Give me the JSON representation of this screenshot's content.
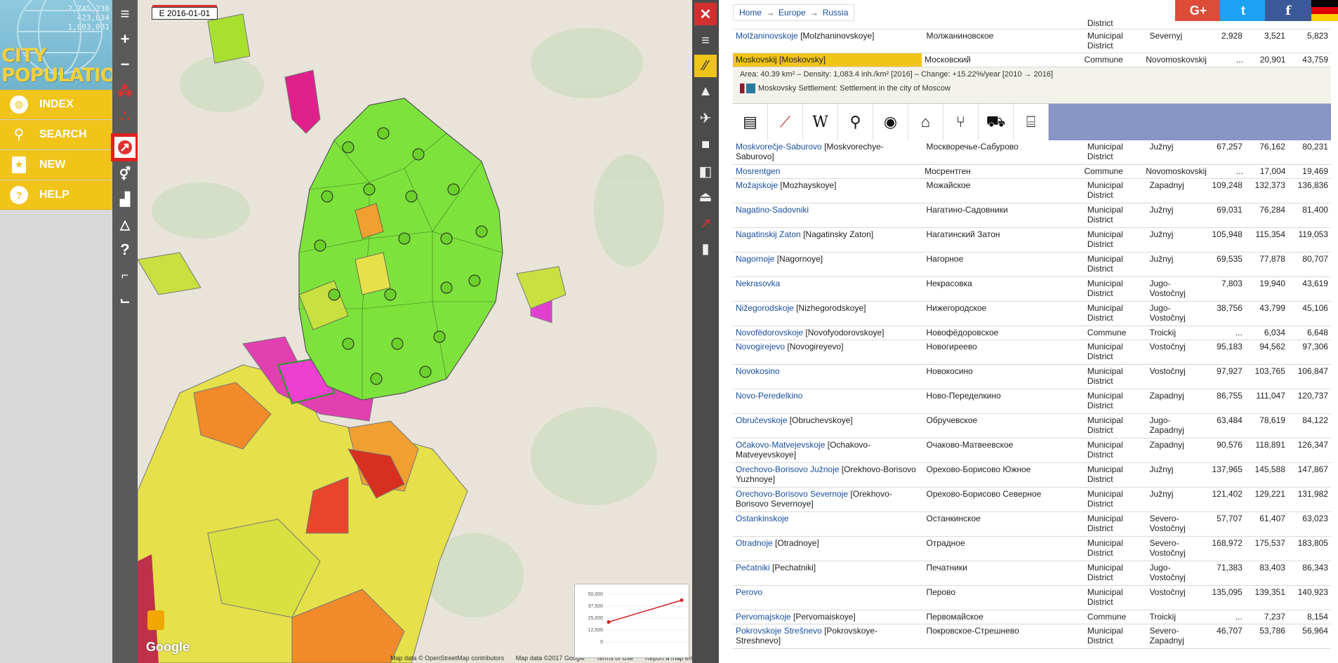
{
  "logo": {
    "counts": [
      "2,745,238",
      "423,034",
      "1,003,081"
    ],
    "line1": "CITY",
    "line2": "POPULATION"
  },
  "menu": [
    {
      "label": "INDEX",
      "icon": "globe-icon"
    },
    {
      "label": "SEARCH",
      "icon": "search-icon"
    },
    {
      "label": "NEW",
      "icon": "star-icon"
    },
    {
      "label": "HELP",
      "icon": "question-icon"
    }
  ],
  "map": {
    "date": "E 2016-01-01",
    "footer": [
      "Map data © OpenStreetMap contributors",
      "Map data ©2017 Google",
      "Terms of Use",
      "Report a map error"
    ],
    "google": "Google",
    "minichart": {
      "ylabels": [
        "50,000",
        "37,500",
        "25,000",
        "12,500",
        "0"
      ],
      "values": [
        20901,
        43759
      ]
    }
  },
  "breadcrumb": [
    "Home",
    "Europe",
    "Russia"
  ],
  "social": {
    "google": "G+",
    "twitter": "t",
    "facebook": "f"
  },
  "selected_detail": {
    "line1": "Area: 40.39 km² – Density: 1,083.4 inh./km² [2016] – Change: +15.22%/year [2010 → 2016]",
    "line2": "Moskovsky Settlement: Settlement in the city of Moscow"
  },
  "rows_top": [
    {
      "name": "",
      "alt": "",
      "cyr": "",
      "status": "District",
      "region": "",
      "p1": "",
      "p2": "",
      "p3": ""
    },
    {
      "name": "Molžaninovskoje",
      "alt": "[Molzhaninovskoye]",
      "cyr": "Молжаниновское",
      "status": "Municipal District",
      "region": "Severnyj",
      "p1": "2,928",
      "p2": "3,521",
      "p3": "5,823"
    },
    {
      "name": "Moskovskij",
      "alt": "[Moskovsky]",
      "cyr": "Московский",
      "status": "Commune",
      "region": "Novomoskovskij",
      "p1": "...",
      "p2": "20,901",
      "p3": "43,759"
    }
  ],
  "rows": [
    {
      "name": "Moskvorečje-Saburovo",
      "alt": "[Moskvorechye-Saburovo]",
      "cyr": "Москворечье-Сабурово",
      "status": "Municipal District",
      "region": "Južnyj",
      "p1": "67,257",
      "p2": "76,162",
      "p3": "80,231"
    },
    {
      "name": "Mosrentgen",
      "alt": "",
      "cyr": "Мосрентген",
      "status": "Commune",
      "region": "Novomoskovskij",
      "p1": "...",
      "p2": "17,004",
      "p3": "19,469"
    },
    {
      "name": "Možajskoje",
      "alt": "[Mozhayskoye]",
      "cyr": "Можайское",
      "status": "Municipal District",
      "region": "Zapadnyj",
      "p1": "109,248",
      "p2": "132,373",
      "p3": "136,836"
    },
    {
      "name": "Nagatino-Sadovniki",
      "alt": "",
      "cyr": "Нагатино-Садовники",
      "status": "Municipal District",
      "region": "Južnyj",
      "p1": "69,031",
      "p2": "76,284",
      "p3": "81,400"
    },
    {
      "name": "Nagatinskij Zaton",
      "alt": "[Nagatinsky Zaton]",
      "cyr": "Нагатинский Затон",
      "status": "Municipal District",
      "region": "Južnyj",
      "p1": "105,948",
      "p2": "115,354",
      "p3": "119,053"
    },
    {
      "name": "Nagornoje",
      "alt": "[Nagornoye]",
      "cyr": "Нагорное",
      "status": "Municipal District",
      "region": "Južnyj",
      "p1": "69,535",
      "p2": "77,878",
      "p3": "80,707"
    },
    {
      "name": "Nekrasovka",
      "alt": "",
      "cyr": "Некрасовка",
      "status": "Municipal District",
      "region": "Jugo-Vostočnyj",
      "p1": "7,803",
      "p2": "19,940",
      "p3": "43,619"
    },
    {
      "name": "Nižegorodskoje",
      "alt": "[Nizhegorodskoye]",
      "cyr": "Нижегородское",
      "status": "Municipal District",
      "region": "Jugo-Vostočnyj",
      "p1": "38,756",
      "p2": "43,799",
      "p3": "45,106"
    },
    {
      "name": "Novofëdorovskoje",
      "alt": "[Novofyodorovskoye]",
      "cyr": "Новофёдоровское",
      "status": "Commune",
      "region": "Troickij",
      "p1": "...",
      "p2": "6,034",
      "p3": "6,648"
    },
    {
      "name": "Novogirejevo",
      "alt": "[Novogireyevo]",
      "cyr": "Новогиреево",
      "status": "Municipal District",
      "region": "Vostočnyj",
      "p1": "95,183",
      "p2": "94,562",
      "p3": "97,306"
    },
    {
      "name": "Novokosino",
      "alt": "",
      "cyr": "Новокосино",
      "status": "Municipal District",
      "region": "Vostočnyj",
      "p1": "97,927",
      "p2": "103,765",
      "p3": "106,847"
    },
    {
      "name": "Novo-Peredelkino",
      "alt": "",
      "cyr": "Ново-Переделкино",
      "status": "Municipal District",
      "region": "Zapadnyj",
      "p1": "86,755",
      "p2": "111,047",
      "p3": "120,737"
    },
    {
      "name": "Obručevskoje",
      "alt": "[Obruchevskoye]",
      "cyr": "Обручевское",
      "status": "Municipal District",
      "region": "Jugo-Zapadnyj",
      "p1": "63,484",
      "p2": "78,619",
      "p3": "84,122"
    },
    {
      "name": "Očakovo-Matvejevskoje",
      "alt": "[Ochakovo-Matveyevskoye]",
      "cyr": "Очаково-Матвеевское",
      "status": "Municipal District",
      "region": "Zapadnyj",
      "p1": "90,576",
      "p2": "118,891",
      "p3": "126,347"
    },
    {
      "name": "Orechovo-Borisovo Južnoje",
      "alt": "[Orekhovo-Borisovo Yuzhnoye]",
      "cyr": "Орехово-Борисово Южное",
      "status": "Municipal District",
      "region": "Južnyj",
      "p1": "137,965",
      "p2": "145,588",
      "p3": "147,867"
    },
    {
      "name": "Orechovo-Borisovo Severnoje",
      "alt": "[Orekhovo-Borisovo Severnoye]",
      "cyr": "Орехово-Борисово Северное",
      "status": "Municipal District",
      "region": "Južnyj",
      "p1": "121,402",
      "p2": "129,221",
      "p3": "131,982"
    },
    {
      "name": "Ostankinskoje",
      "alt": "",
      "cyr": "Останкинское",
      "status": "Municipal District",
      "region": "Severo-Vostočnyj",
      "p1": "57,707",
      "p2": "61,407",
      "p3": "63,023"
    },
    {
      "name": "Otradnoje",
      "alt": "[Otradnoye]",
      "cyr": "Отрадное",
      "status": "Municipal District",
      "region": "Severo-Vostočnyj",
      "p1": "168,972",
      "p2": "175,537",
      "p3": "183,805"
    },
    {
      "name": "Pečatniki",
      "alt": "[Pechatniki]",
      "cyr": "Печатники",
      "status": "Municipal District",
      "region": "Jugo-Vostočnyj",
      "p1": "71,383",
      "p2": "83,403",
      "p3": "86,343"
    },
    {
      "name": "Perovo",
      "alt": "",
      "cyr": "Перово",
      "status": "Municipal District",
      "region": "Vostočnyj",
      "p1": "135,095",
      "p2": "139,351",
      "p3": "140,923"
    },
    {
      "name": "Pervomajskoje",
      "alt": "[Pervomaiskoye]",
      "cyr": "Первомайское",
      "status": "Commune",
      "region": "Troickij",
      "p1": "...",
      "p2": "7,237",
      "p3": "8,154"
    },
    {
      "name": "Pokrovskoje Strešnevo",
      "alt": "[Pokrovskoye-Streshnevo]",
      "cyr": "Покровское-Стрешнево",
      "status": "Municipal District",
      "region": "Severo-Zapadnyj",
      "p1": "46,707",
      "p2": "53,786",
      "p3": "56,964"
    }
  ]
}
